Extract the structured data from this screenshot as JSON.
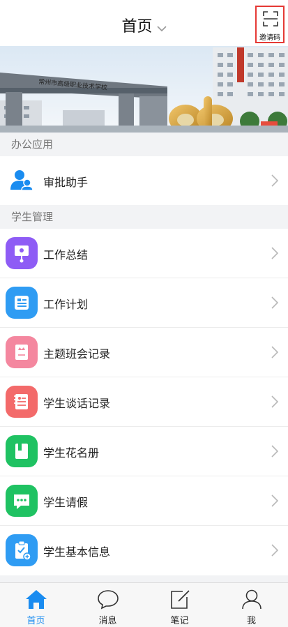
{
  "header": {
    "title": "首页",
    "invite_label": "邀请码"
  },
  "sections": {
    "office": {
      "title": "办公应用",
      "items": [
        {
          "label": "审批助手",
          "icon": "approval-person-icon"
        }
      ]
    },
    "students": {
      "title": "学生管理",
      "items": [
        {
          "label": "工作总结",
          "icon": "presentation-board-icon",
          "color": "#8e5cf5"
        },
        {
          "label": "工作计划",
          "icon": "plan-document-icon",
          "color": "#2f9cf3"
        },
        {
          "label": "主题班会记录",
          "icon": "meeting-book-icon",
          "color": "#f4879f"
        },
        {
          "label": "学生谈话记录",
          "icon": "conversation-notes-icon",
          "color": "#f36a6a"
        },
        {
          "label": "学生花名册",
          "icon": "roster-book-icon",
          "color": "#1fc262"
        },
        {
          "label": "学生请假",
          "icon": "leave-chat-icon",
          "color": "#1fc262"
        },
        {
          "label": "学生基本信息",
          "icon": "info-clipboard-icon",
          "color": "#2f9cf3"
        }
      ]
    }
  },
  "tabbar": [
    {
      "label": "首页",
      "icon": "home-icon",
      "active": true
    },
    {
      "label": "消息",
      "icon": "message-icon",
      "active": false
    },
    {
      "label": "笔记",
      "icon": "note-icon",
      "active": false
    },
    {
      "label": "我",
      "icon": "profile-icon",
      "active": false
    }
  ],
  "colors": {
    "accent": "#1a8cf0",
    "invite_border": "#e53935"
  }
}
